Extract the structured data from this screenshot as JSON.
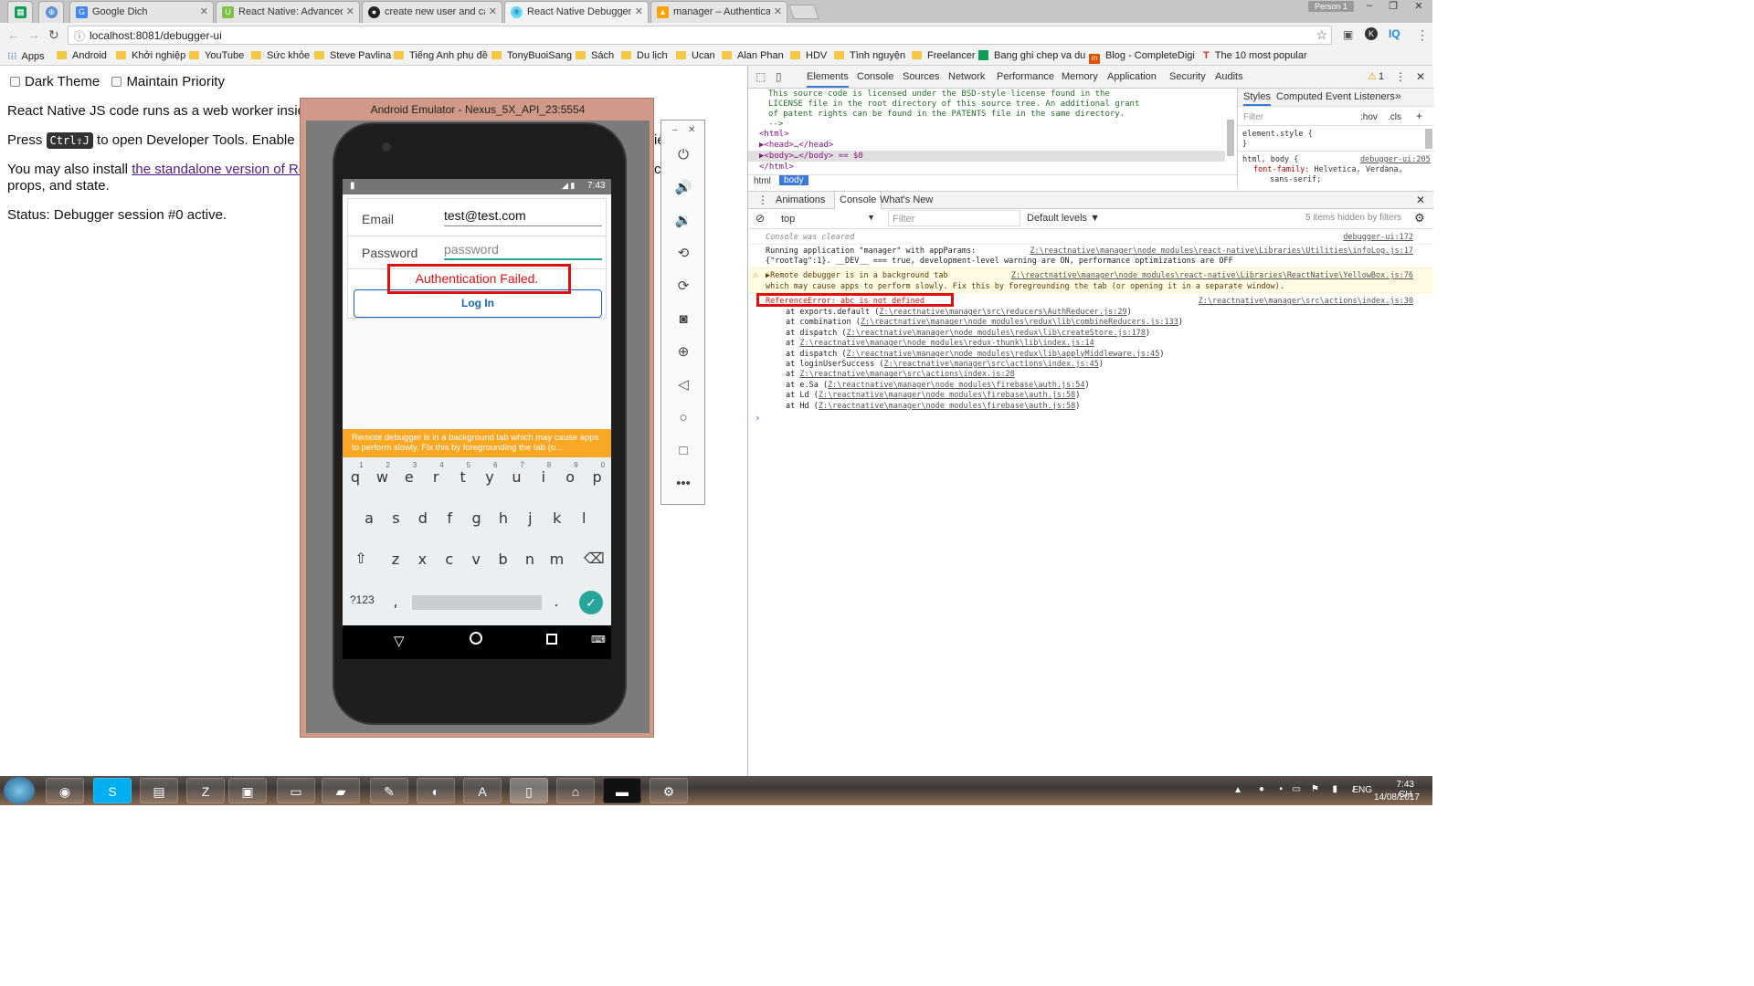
{
  "browser": {
    "tabs": [
      {
        "title": "Google Dich",
        "favicon": "translate"
      },
      {
        "title": "React Native: Advanced C",
        "favicon": "udemy"
      },
      {
        "title": "create new user and catc",
        "favicon": "github"
      },
      {
        "title": "React Native Debugger",
        "favicon": "react"
      },
      {
        "title": "manager – Authenticatio",
        "favicon": "firebase"
      }
    ],
    "profile": "Person 1",
    "url": "localhost:8081/debugger-ui",
    "bookmarks": [
      "Apps",
      "Android",
      "Khởi nghiệp",
      "YouTube",
      "Sức khỏe",
      "Steve Pavlina",
      "Tiếng Anh phụ đề",
      "TonyBuoiSang",
      "Sách",
      "Du lịch",
      "Ucan",
      "Alan Phan",
      "HDV",
      "Tình nguyện",
      "Freelancer",
      "Bang ghi chep va du",
      "Blog - CompleteDigi",
      "The 10 most popular"
    ]
  },
  "page": {
    "dark_theme": "Dark Theme",
    "maintain_priority": "Maintain Priority",
    "line1": "React Native JS code runs as a web worker insid",
    "press": "Press",
    "shortcut": "Ctrl⇧J",
    "line2_rest": "to open Developer Tools. Enable",
    "line2_tail": "ie",
    "line3_pre": "You may also install",
    "line3_link": "the standalone version of Re",
    "line3_tail": "ch",
    "line3_cont": "props, and state.",
    "status": "Status: Debugger session #0 active."
  },
  "emulator": {
    "title": "Android Emulator - Nexus_5X_API_23:5554",
    "time": "7:43",
    "email_label": "Email",
    "email_value": "test@test.com",
    "password_label": "Password",
    "password_placeholder": "password",
    "error": "Authentication Failed.",
    "login_button": "Log In",
    "yellowbox": "Remote debugger is in a background tab which may cause apps to perform slowly. Fix this by foregrounding the tab (o...",
    "keys_row1": [
      "q",
      "w",
      "e",
      "r",
      "t",
      "y",
      "u",
      "i",
      "o",
      "p"
    ],
    "keys_row1_nums": [
      "1",
      "2",
      "3",
      "4",
      "5",
      "6",
      "7",
      "8",
      "9",
      "0"
    ],
    "keys_row2": [
      "a",
      "s",
      "d",
      "f",
      "g",
      "h",
      "j",
      "k",
      "l"
    ],
    "keys_row3": [
      "z",
      "x",
      "c",
      "v",
      "b",
      "n",
      "m"
    ],
    "key_symbols": "?123",
    "key_comma": ",",
    "key_period": "."
  },
  "devtools": {
    "tabs": [
      "Elements",
      "Console",
      "Sources",
      "Network",
      "Performance",
      "Memory",
      "Application",
      "Security",
      "Audits"
    ],
    "warn_count": "1",
    "source_lines": [
      "This source code is licensed under the BSD-style license found in the",
      "LICENSE file in the root directory of this source tree. An additional grant",
      "of patent rights can be found in the PATENTS file in the same directory.",
      "-->",
      "<html>",
      "▶<head>…</head>",
      "▶<body>…</body> == $0",
      "</html>"
    ],
    "crumbs": [
      "html",
      "body"
    ],
    "styles_tabs": [
      "Styles",
      "Computed",
      "Event Listeners"
    ],
    "styles_filter": "Filter",
    "styles_hov": ":hov",
    "styles_cls": ".cls",
    "element_style": "element.style {",
    "close_brace": "}",
    "rule_selector": "html, body {",
    "rule_source": "debugger-ui:205",
    "rule_prop": "font-family",
    "rule_value": "Helvetica, Verdana,",
    "rule_value2": "sans-serif;",
    "drawer_tabs": [
      "Animations",
      "Console",
      "What's New"
    ],
    "context": "top",
    "filter_placeholder": "Filter",
    "levels": "Default levels ▼",
    "hidden": "5 items hidden by filters",
    "console": {
      "cleared": "Console was cleared",
      "cleared_src": "debugger-ui:172",
      "run1": "Running application \"manager\" with appParams:",
      "run2": "{\"rootTag\":1}. __DEV__ === true, development-level warning are ON, performance optimizations are OFF",
      "run_src": "Z:\\reactnative\\manager\\node_modules\\react-native\\Libraries\\Utilities\\infoLog.js:17",
      "warn1": "▶Remote debugger is in a background tab",
      "warn2": "which may cause apps to perform slowly. Fix this by foregrounding the tab (or opening it in a separate window).",
      "warn_src": "Z:\\reactnative\\manager\\node_modules\\react-native\\Libraries\\ReactNative\\YellowBox.js:76",
      "error": "ReferenceError: abc is not defined",
      "error_src": "Z:\\reactnative\\manager\\src\\actions\\index.js:30",
      "stack": [
        {
          "pre": "at exports.default (",
          "link": "Z:\\reactnative\\manager\\src\\reducers\\AuthReducer.js:29",
          "post": ")"
        },
        {
          "pre": "at combination (",
          "link": "Z:\\reactnative\\manager\\node_modules\\redux\\lib\\combineReducers.js:133",
          "post": ")"
        },
        {
          "pre": "at dispatch (",
          "link": "Z:\\reactnative\\manager\\node_modules\\redux\\lib\\createStore.js:178",
          "post": ")"
        },
        {
          "pre": "at ",
          "link": "Z:\\reactnative\\manager\\node_modules\\redux-thunk\\lib\\index.js:14",
          "post": ""
        },
        {
          "pre": "at dispatch (",
          "link": "Z:\\reactnative\\manager\\node_modules\\redux\\lib\\applyMiddleware.js:45",
          "post": ")"
        },
        {
          "pre": "at loginUserSuccess (",
          "link": "Z:\\reactnative\\manager\\src\\actions\\index.js:45",
          "post": ")"
        },
        {
          "pre": "at ",
          "link": "Z:\\reactnative\\manager\\src\\actions\\index.js:28",
          "post": ""
        },
        {
          "pre": "at e.Sa (",
          "link": "Z:\\reactnative\\manager\\node_modules\\firebase\\auth.js:54",
          "post": ")"
        },
        {
          "pre": "at Ld (",
          "link": "Z:\\reactnative\\manager\\node_modules\\firebase\\auth.js:58",
          "post": ")"
        },
        {
          "pre": "at Hd (",
          "link": "Z:\\reactnative\\manager\\node_modules\\firebase\\auth.js:58",
          "post": ")"
        }
      ]
    }
  },
  "taskbar": {
    "lang": "ENG",
    "time": "7:43 CH",
    "date": "14/08/2017"
  },
  "colors": {
    "error_red": "#e01010",
    "link_blue": "#1565c0",
    "yellowbox": "#f9a825",
    "accent_teal": "#26a69a"
  }
}
